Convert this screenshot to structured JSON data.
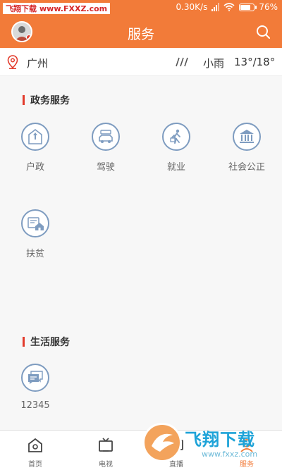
{
  "status_bar": {
    "watermark_text_a": "飞翔下载",
    "watermark_text_b": "www.FXXZ.com",
    "speed": "0.30K/s",
    "battery": "76%"
  },
  "header": {
    "title": "服务"
  },
  "weather": {
    "city": "广州",
    "description": "小雨",
    "temperature": "13°/18°"
  },
  "sections": [
    {
      "title": "政务服务",
      "items": [
        {
          "label": "户政",
          "icon": "household-icon"
        },
        {
          "label": "驾驶",
          "icon": "car-icon"
        },
        {
          "label": "就业",
          "icon": "employment-icon"
        },
        {
          "label": "社会公正",
          "icon": "courthouse-icon"
        },
        {
          "label": "扶贫",
          "icon": "poverty-relief-icon"
        }
      ]
    },
    {
      "title": "生活服务",
      "items": [
        {
          "label": "12345",
          "icon": "chat-icon"
        }
      ]
    }
  ],
  "bottom_nav": [
    {
      "label": "首页",
      "icon": "home-icon"
    },
    {
      "label": "电视",
      "icon": "tv-icon"
    },
    {
      "label": "直播",
      "icon": "live-icon"
    },
    {
      "label": "服务",
      "icon": "service-icon",
      "active": true
    }
  ],
  "watermark_logo": {
    "title": "飞翔下载",
    "domain": "www.fxxz.com"
  },
  "colors": {
    "brand_orange": "#f27b39",
    "section_bar_red": "#e23a2b",
    "icon_blue": "#7e9cc0"
  }
}
